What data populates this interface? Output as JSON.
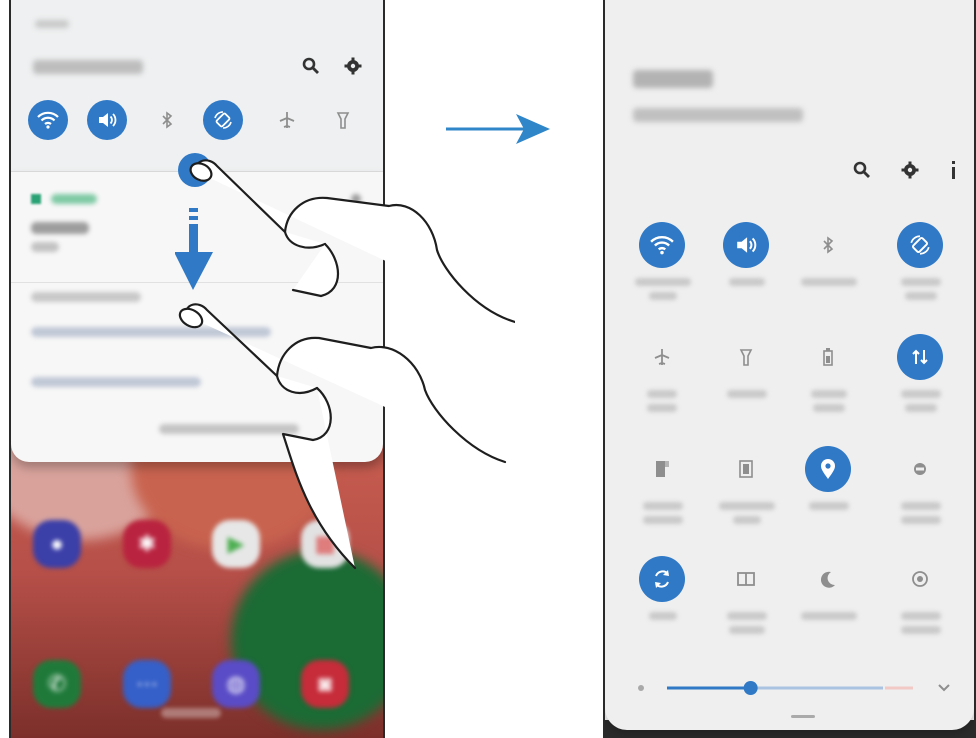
{
  "left_phone": {
    "quick_toggles": [
      {
        "name": "wifi",
        "state": "on"
      },
      {
        "name": "sound",
        "state": "on"
      },
      {
        "name": "bluetooth",
        "state": "off"
      },
      {
        "name": "auto-rotate",
        "state": "on"
      },
      {
        "name": "airplane-mode",
        "state": "off"
      },
      {
        "name": "flashlight",
        "state": "off"
      }
    ],
    "header_icons": [
      "search-icon",
      "gear-icon"
    ],
    "home_apps_row1": [
      {
        "icon": "store-icon",
        "color": "#3b3fa8"
      },
      {
        "icon": "settings-flower-icon",
        "color": "#b9233f"
      },
      {
        "icon": "play-store-icon",
        "color": "#e7e7e7"
      },
      {
        "icon": "app-folder-icon",
        "color": "#e2e2e2"
      }
    ],
    "home_apps_row2": [
      {
        "icon": "phone-icon",
        "color": "#1f7a3a"
      },
      {
        "icon": "messages-icon",
        "color": "#3560c9"
      },
      {
        "icon": "internet-icon",
        "color": "#5a4cc6"
      },
      {
        "icon": "camera-icon",
        "color": "#c62c3a"
      }
    ]
  },
  "right_phone": {
    "header_icons": [
      "search-icon",
      "gear-icon",
      "more-options-icon"
    ],
    "tiles": [
      {
        "icon": "wifi-icon",
        "state": "on"
      },
      {
        "icon": "sound-icon",
        "state": "on"
      },
      {
        "icon": "bluetooth-icon",
        "state": "off"
      },
      {
        "icon": "auto-rotate-icon",
        "state": "on"
      },
      {
        "icon": "airplane-icon",
        "state": "off"
      },
      {
        "icon": "flashlight-icon",
        "state": "off"
      },
      {
        "icon": "battery-icon",
        "state": "off"
      },
      {
        "icon": "mobile-data-icon",
        "state": "on"
      },
      {
        "icon": "nfc-icon",
        "state": "off"
      },
      {
        "icon": "screen-icon",
        "state": "off"
      },
      {
        "icon": "location-icon",
        "state": "on"
      },
      {
        "icon": "hotspot-icon",
        "state": "off"
      },
      {
        "icon": "sync-icon",
        "state": "on"
      },
      {
        "icon": "dual-screen-icon",
        "state": "off"
      },
      {
        "icon": "night-mode-icon",
        "state": "off"
      },
      {
        "icon": "focus-icon",
        "state": "off"
      }
    ],
    "brightness_level": 0.34
  },
  "colors": {
    "accent": "#2f79c6",
    "panel": "#efefef",
    "arrow": "#2f86c9"
  }
}
